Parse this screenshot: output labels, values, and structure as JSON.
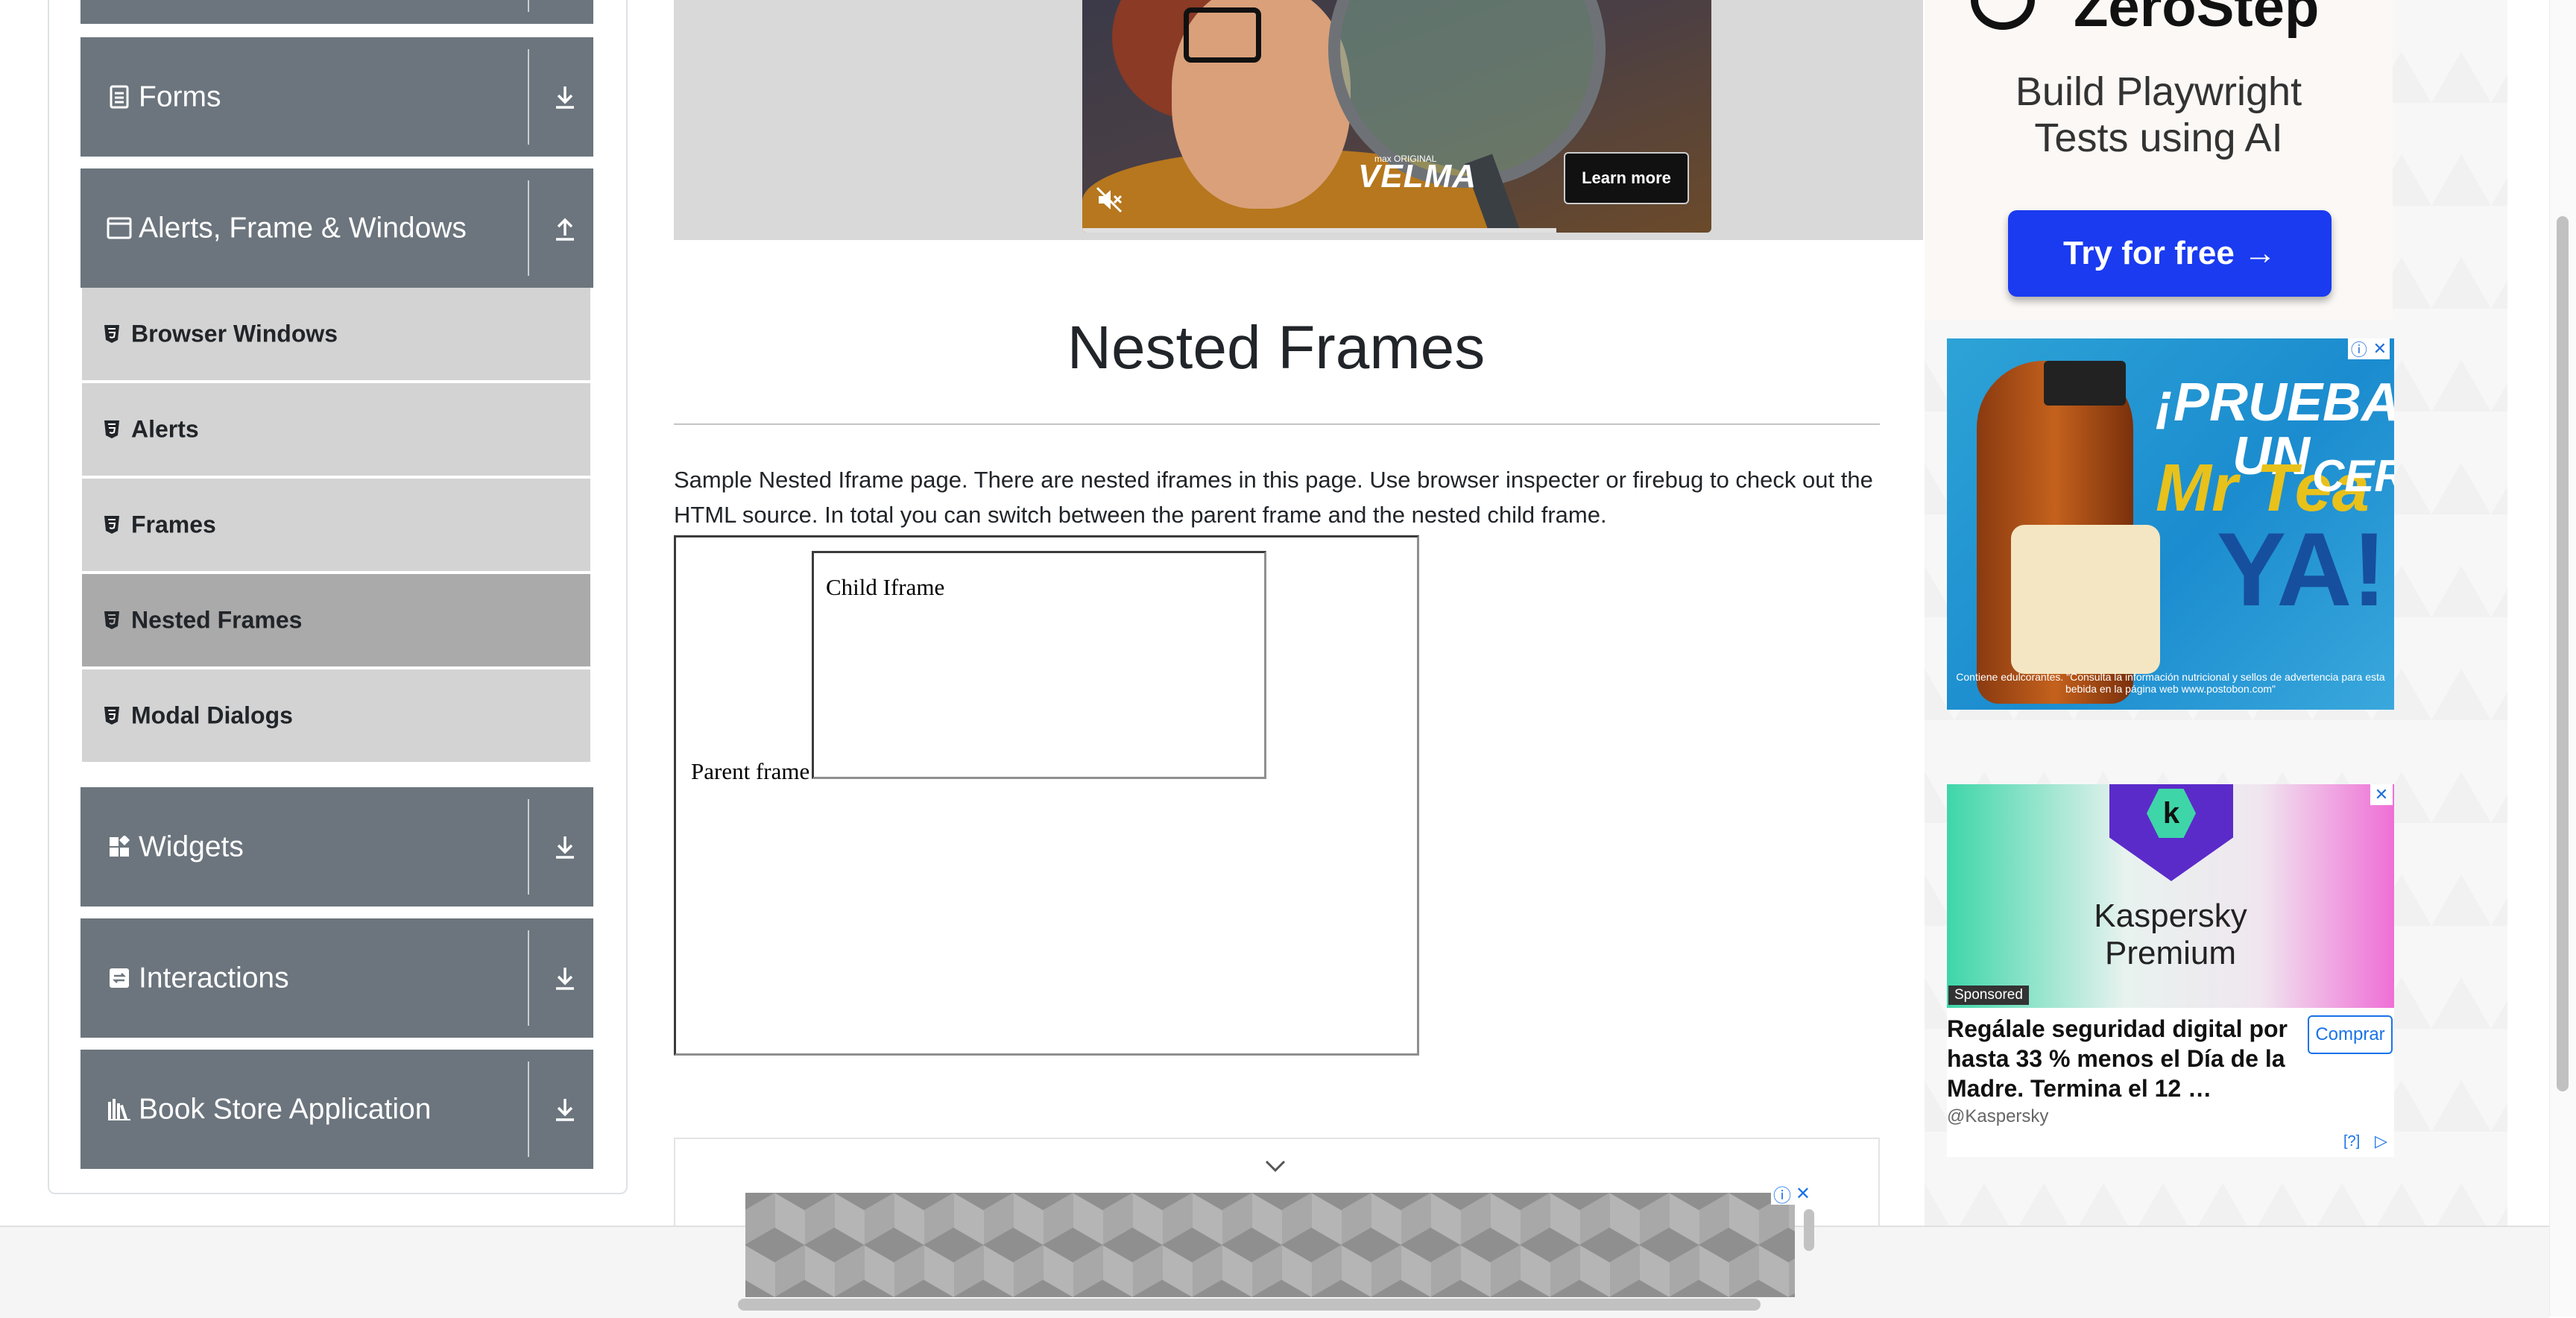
{
  "sidebar": {
    "groups": [
      {
        "label": "Forms",
        "icon": "document-icon",
        "expanded": false
      },
      {
        "label": "Alerts, Frame & Windows",
        "icon": "window-icon",
        "expanded": true
      },
      {
        "label": "Widgets",
        "icon": "widgets-icon",
        "expanded": false
      },
      {
        "label": "Interactions",
        "icon": "interactions-icon",
        "expanded": false
      },
      {
        "label": "Book Store Application",
        "icon": "books-icon",
        "expanded": false
      }
    ],
    "alert_items": [
      {
        "label": "Browser Windows",
        "active": false
      },
      {
        "label": "Alerts",
        "active": false
      },
      {
        "label": "Frames",
        "active": false
      },
      {
        "label": "Nested Frames",
        "active": true
      },
      {
        "label": "Modal Dialogs",
        "active": false
      }
    ]
  },
  "video_ad": {
    "brand_small": "max ORIGINAL",
    "brand": "VELMA",
    "cta": "Learn more"
  },
  "main": {
    "title": "Nested Frames",
    "description": "Sample Nested Iframe page. There are nested iframes in this page. Use browser inspecter or firebug to check out the HTML source. In total you can switch between the parent frame and the nested child frame.",
    "parent_frame_text": "Parent frame",
    "child_frame_text": "Child Iframe"
  },
  "ads": {
    "zerostep": {
      "logo": "ZeroStep",
      "headline_line1": "Build Playwright",
      "headline_line2": "Tests using AI",
      "button": "Try for free →"
    },
    "tea": {
      "line1": "¡PRUEBA UN",
      "brand": "Mr Tea",
      "cero": "CERO",
      "ya": "YA!",
      "disclaimer": "Contiene edulcorantes. \"Consulta la información nutricional y sellos de advertencia para esta bebida en la página web www.postobon.com\""
    },
    "kaspersky": {
      "logo_letter": "k",
      "title_line1": "Kaspersky",
      "title_line2": "Premium",
      "sponsored": "Sponsored",
      "text": "Regálale seguridad digital por hasta 33 % menos el Día de la Madre. Termina el 12 …",
      "handle": "@Kaspersky",
      "buy": "Comprar",
      "help": "[?]"
    }
  },
  "colors": {
    "group_header_bg": "#6c757d",
    "menu_item_bg": "#d3d3d3",
    "menu_item_active_bg": "#aaaaaa",
    "zerostep_button": "#1a3bf0"
  }
}
